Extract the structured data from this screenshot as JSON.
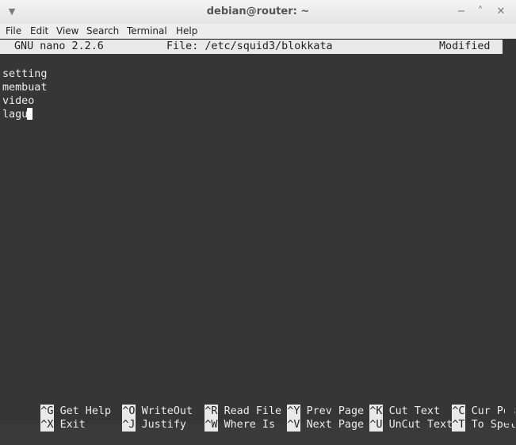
{
  "window": {
    "title": "debian@router: ~",
    "menu_icon": "chevron-down-icon",
    "minimize_icon": "minimize-icon",
    "maximize_icon": "maximize-icon",
    "close_icon": "close-icon"
  },
  "menubar": {
    "items": [
      "File",
      "Edit",
      "View",
      "Search",
      "Terminal",
      "Help"
    ]
  },
  "nano": {
    "version": "GNU nano 2.2.6",
    "file": "File: /etc/squid3/blokkata",
    "status": "Modified"
  },
  "content": {
    "lines": [
      "setting",
      "membuat",
      "video",
      "lagu"
    ]
  },
  "shortcuts": {
    "row1": [
      {
        "key": "^G",
        "action": "Get Help"
      },
      {
        "key": "^O",
        "action": "WriteOut"
      },
      {
        "key": "^R",
        "action": "Read File"
      },
      {
        "key": "^Y",
        "action": "Prev Page"
      },
      {
        "key": "^K",
        "action": "Cut Text"
      },
      {
        "key": "^C",
        "action": "Cur Pos"
      }
    ],
    "row2": [
      {
        "key": "^X",
        "action": "Exit"
      },
      {
        "key": "^J",
        "action": "Justify"
      },
      {
        "key": "^W",
        "action": "Where Is"
      },
      {
        "key": "^V",
        "action": "Next Page"
      },
      {
        "key": "^U",
        "action": "UnCut Text"
      },
      {
        "key": "^T",
        "action": "To Spell"
      }
    ]
  }
}
